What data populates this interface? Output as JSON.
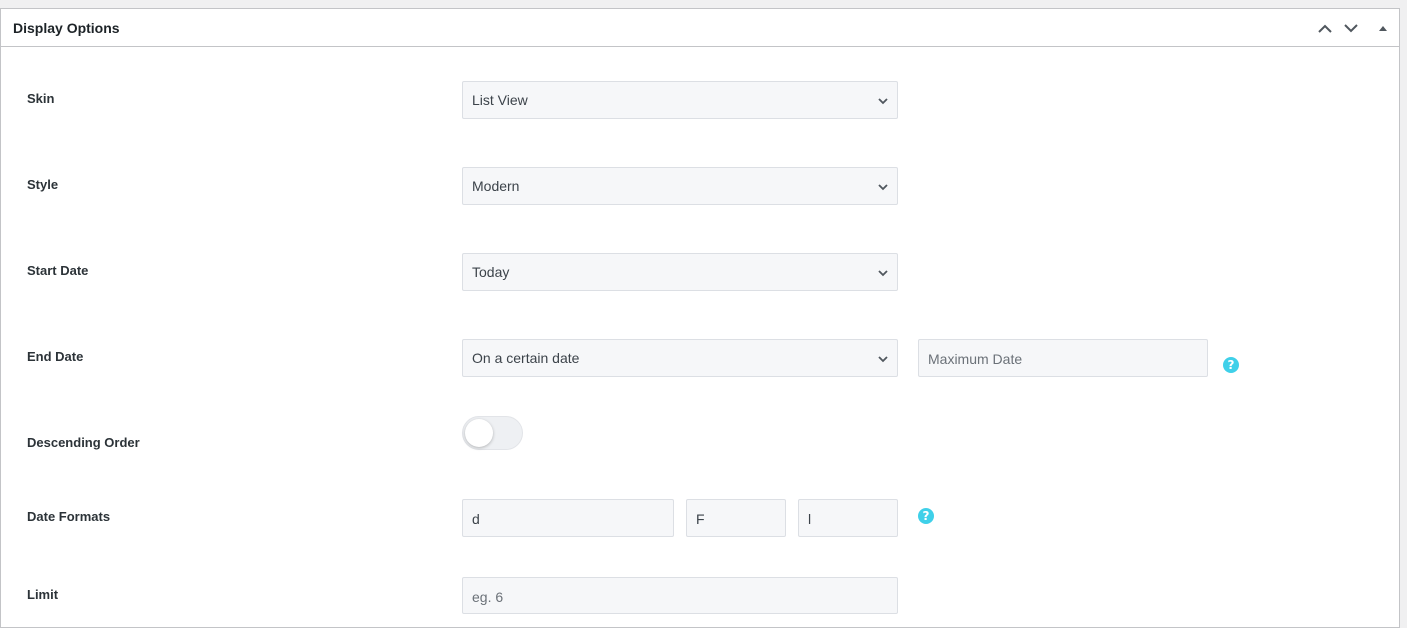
{
  "panel": {
    "title": "Display Options",
    "controls": {
      "move_up": "chevron-up-icon",
      "move_down": "chevron-down-icon",
      "collapse": "triangle-up-icon"
    }
  },
  "fields": {
    "skin": {
      "label": "Skin",
      "value": "List View"
    },
    "style": {
      "label": "Style",
      "value": "Modern"
    },
    "start_date": {
      "label": "Start Date",
      "value": "Today"
    },
    "end_date": {
      "label": "End Date",
      "value": "On a certain date",
      "max_date_placeholder": "Maximum Date",
      "help": "?"
    },
    "descending_order": {
      "label": "Descending Order",
      "enabled": false
    },
    "date_formats": {
      "label": "Date Formats",
      "part1": "d",
      "part2": "F",
      "part3": "l",
      "help": "?"
    },
    "limit": {
      "label": "Limit",
      "placeholder": "eg. 6"
    }
  },
  "colors": {
    "help_badge": "#3fd0e9",
    "field_bg": "#f6f7f9",
    "border": "#c3c4c7"
  }
}
